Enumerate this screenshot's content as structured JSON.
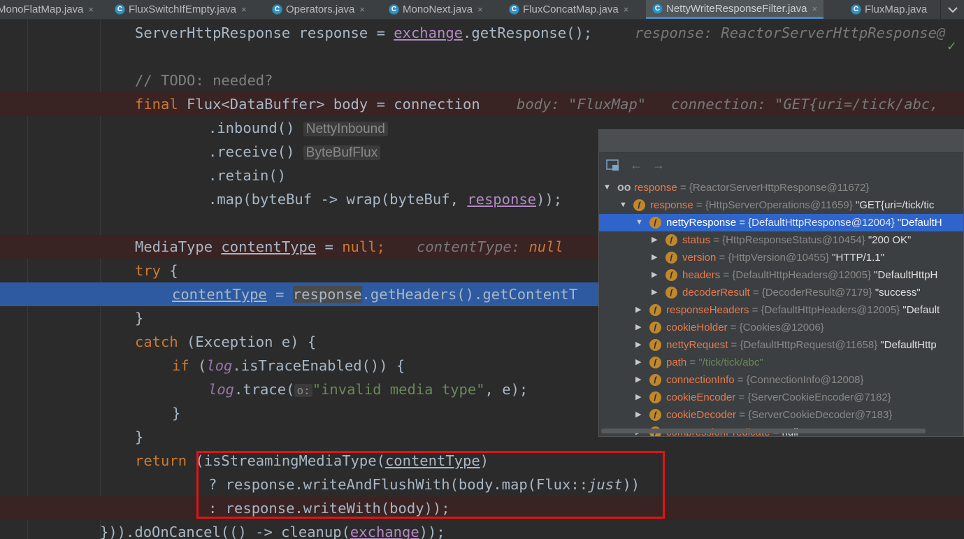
{
  "tabs": [
    {
      "label": "MonoFlatMap.java",
      "active": false,
      "icon": "class-icon"
    },
    {
      "label": "FluxSwitchIfEmpty.java",
      "active": false,
      "icon": "class-icon"
    },
    {
      "label": "Operators.java",
      "active": false,
      "icon": "class-icon"
    },
    {
      "label": "MonoNext.java",
      "active": false,
      "icon": "class-icon"
    },
    {
      "label": "FluxConcatMap.java",
      "active": false,
      "icon": "class-icon"
    },
    {
      "label": "NettyWriteResponseFilter.java",
      "active": true,
      "icon": "class-icon"
    },
    {
      "label": "FluxMap.java",
      "active": false,
      "icon": "class-icon"
    }
  ],
  "tab_close_glyph": "×",
  "tab_more_icon": "chevron-down-icon",
  "code": {
    "l1": {
      "a": "ServerHttpResponse response = ",
      "b": "exchange",
      "c": ".getResponse();",
      "hint": "response: ReactorServerHttpResponse@"
    },
    "l3": {
      "comment": "// TODO: needed?"
    },
    "l4": {
      "kw": "final",
      "a": " Flux<DataBuffer> body = connection",
      "hint1": "body: \"FluxMap\"",
      "hint2": "connection: \"GET{uri=/tick/abc,"
    },
    "l5": {
      "a": ".inbound()",
      "inlay": "NettyInbound"
    },
    "l6": {
      "a": ".receive()",
      "inlay": "ByteBufFlux"
    },
    "l7": {
      "a": ".retain()"
    },
    "l8": {
      "a": ".map(byteBuf -> wrap(byteBuf, ",
      "b": "response",
      "c": "));"
    },
    "l10": {
      "a": "MediaType ",
      "b": "contentType",
      "c": " = ",
      "kw": "null",
      "d": ";",
      "hint1": "contentType: ",
      "hint2": "null"
    },
    "l11": {
      "kw": "try",
      "a": " {"
    },
    "l12": {
      "a": "contentType",
      "b": " = ",
      "c": "response",
      "d": ".getHeaders().getContentT"
    },
    "l13": {
      "a": "}"
    },
    "l14": {
      "kw": "catch",
      "a": " (Exception e) {"
    },
    "l15": {
      "kw": "if",
      "a": " (",
      "f": "log",
      "b": ".isTraceEnabled()) {"
    },
    "l16": {
      "f": "log",
      "a": ".trace(",
      "p": "o:",
      "s": "\"invalid media type\"",
      "b": ", e);"
    },
    "l17": {
      "a": "}"
    },
    "l18": {
      "a": "}"
    },
    "l19": {
      "kw": "return",
      "a": " (isStreamingMediaType(",
      "b": "contentType",
      "c": ")"
    },
    "l20": {
      "a": "? response.writeAndFlushWith(body.map(Flux::",
      "i": "just",
      "b": "))"
    },
    "l21": {
      "a": ": response.writeWith(body));"
    },
    "l22": {
      "a": "})).doOnCancel(() -> cleanup(",
      "b": "exchange",
      "c": "));"
    }
  },
  "popup": {
    "toolbar_icons": [
      "layout-icon",
      "back-arrow-icon",
      "forward-arrow-icon"
    ],
    "rows": [
      {
        "name": "response",
        "type": " = {ReactorServerHttpResponse@11672}",
        "val": "",
        "expanded": true,
        "icon": "watch-icon"
      },
      {
        "name": "response",
        "type": " = {HttpServerOperations@11659}",
        "val": " \"GET{uri=/tick/tic",
        "expanded": true,
        "icon": "field-icon"
      },
      {
        "name": "nettyResponse",
        "type": " = {DefaultHttpResponse@12004}",
        "val": " \"DefaultH",
        "expanded": true,
        "icon": "field-icon",
        "selected": true
      },
      {
        "name": "status",
        "type": " = {HttpResponseStatus@10454}",
        "val": " \"200 OK\"",
        "expanded": false,
        "icon": "field-icon"
      },
      {
        "name": "version",
        "type": " = {HttpVersion@10455}",
        "val": " \"HTTP/1.1\"",
        "expanded": false,
        "icon": "field-icon"
      },
      {
        "name": "headers",
        "type": " = {DefaultHttpHeaders@12005}",
        "val": " \"DefaultHttpH",
        "expanded": false,
        "icon": "field-icon"
      },
      {
        "name": "decoderResult",
        "type": " = {DecoderResult@7179}",
        "val": " \"success\"",
        "expanded": false,
        "icon": "field-icon"
      },
      {
        "name": "responseHeaders",
        "type": " = {DefaultHttpHeaders@12005}",
        "val": " \"Default",
        "expanded": false,
        "icon": "field-icon"
      },
      {
        "name": "cookieHolder",
        "type": " = {Cookies@12006}",
        "val": "",
        "expanded": false,
        "icon": "field-icon"
      },
      {
        "name": "nettyRequest",
        "type": " = {DefaultHttpRequest@11658}",
        "val": " \"DefaultHttp",
        "expanded": false,
        "icon": "field-icon"
      },
      {
        "name": "path",
        "type": " = ",
        "val": "\"/tick/tick/abc\"",
        "expanded": false,
        "icon": "field-icon",
        "strval": true
      },
      {
        "name": "connectionInfo",
        "type": " = {ConnectionInfo@12008}",
        "val": "",
        "expanded": false,
        "icon": "field-icon"
      },
      {
        "name": "cookieEncoder",
        "type": " = {ServerCookieEncoder@7182}",
        "val": "",
        "expanded": false,
        "icon": "field-icon"
      },
      {
        "name": "cookieDecoder",
        "type": " = {ServerCookieDecoder@7183}",
        "val": "",
        "expanded": false,
        "icon": "field-icon"
      },
      {
        "name": "compressionPredicate",
        "type": " = ",
        "val": "null",
        "expanded": false,
        "icon": "field-icon"
      }
    ]
  },
  "colors": {
    "accent": "#2f65ca",
    "exec_line": "#2d5aa0",
    "breakpoint_line": "#3a2323",
    "highlight_box": "#e01414"
  }
}
